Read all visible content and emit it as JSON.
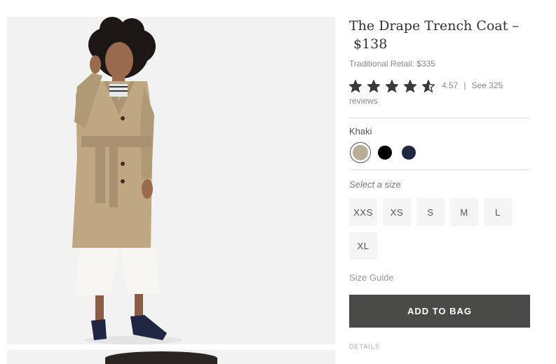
{
  "product": {
    "title": "The Drape Trench Coat –",
    "price": "$138",
    "retail": "Traditional Retail: $335",
    "rating": {
      "value": "4.57",
      "stars": 4.57,
      "separator": "|",
      "reviews_link": "See 325 reviews"
    },
    "color": {
      "selected_label": "Khaki",
      "swatches": [
        {
          "name": "khaki-swatch",
          "hex": "#b9ad98"
        },
        {
          "name": "black-swatch",
          "hex": "#000000"
        },
        {
          "name": "navy-swatch",
          "hex": "#1f2742"
        }
      ]
    },
    "size_prompt": "Select a size",
    "sizes": [
      "XXS",
      "XS",
      "S",
      "M",
      "L",
      "XL"
    ],
    "size_guide": "Size Guide",
    "add_to_bag": "ADD TO BAG",
    "details_label": "DETAILS"
  },
  "colors": {
    "button_bg": "#4a4a48",
    "star": "#3a3a3a",
    "photo_bg": "#f2f2f2"
  }
}
